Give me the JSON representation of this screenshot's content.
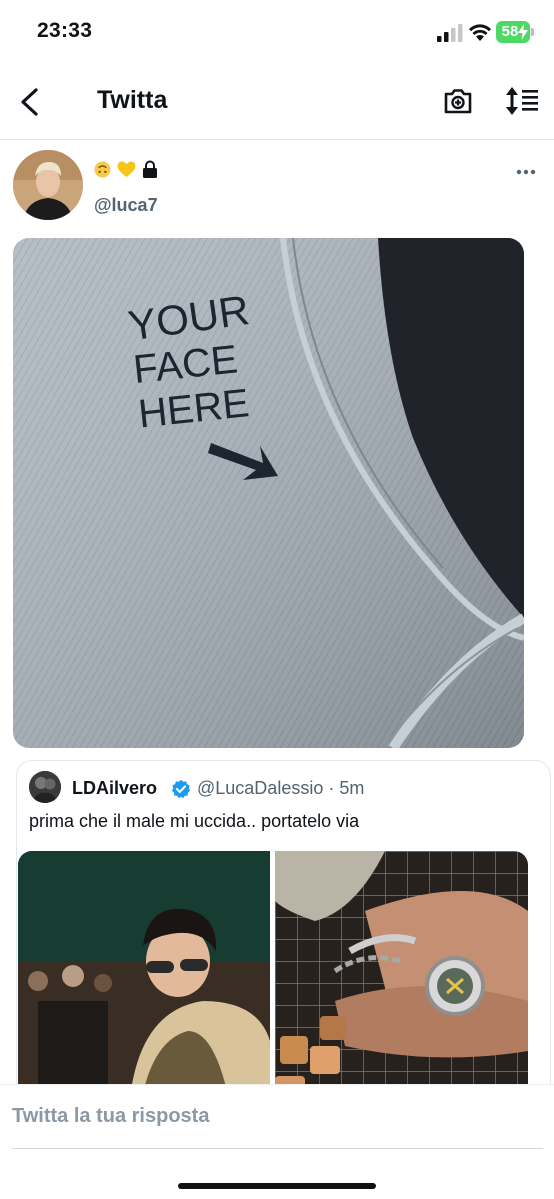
{
  "status_bar": {
    "time": "23:33",
    "battery": "58"
  },
  "nav": {
    "title": "Twitta",
    "icons": [
      "back-icon",
      "camera-plus-icon",
      "sort-icon"
    ]
  },
  "tweet": {
    "handle": "@luca7",
    "display_icons": [
      "upside-down-face-emoji",
      "yellow-heart-emoji",
      "lock-icon"
    ],
    "media_text": [
      "YOUR",
      "FACE",
      "HERE"
    ]
  },
  "quote": {
    "name": "LDAilvero",
    "handle_time": "@LucaDalessio · 5m",
    "text": "prima che il male mi uccida.. portatelo via"
  },
  "reply": {
    "placeholder": "Twitta la tua risposta"
  },
  "colors": {
    "accent": "#1d9bf0",
    "muted": "#536471",
    "battery": "#4cd964"
  }
}
